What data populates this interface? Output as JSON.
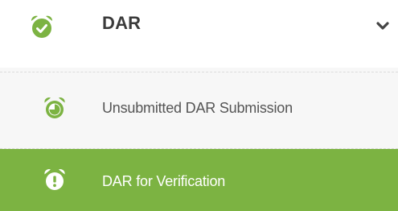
{
  "colors": {
    "accent": "#7cb342",
    "text_dark": "#3a3a3a",
    "text_muted": "#555555",
    "submenu_bg": "#f7f7f7"
  },
  "menu": {
    "group": {
      "label": "DAR",
      "icon": "alarm-clock-check-icon",
      "expand_icon": "chevron-down-icon"
    },
    "items": [
      {
        "label": "Unsubmitted DAR Submission",
        "icon": "alarm-clock-icon",
        "active": false
      },
      {
        "label": "DAR for Verification",
        "icon": "alarm-clock-alert-icon",
        "active": true
      }
    ]
  }
}
